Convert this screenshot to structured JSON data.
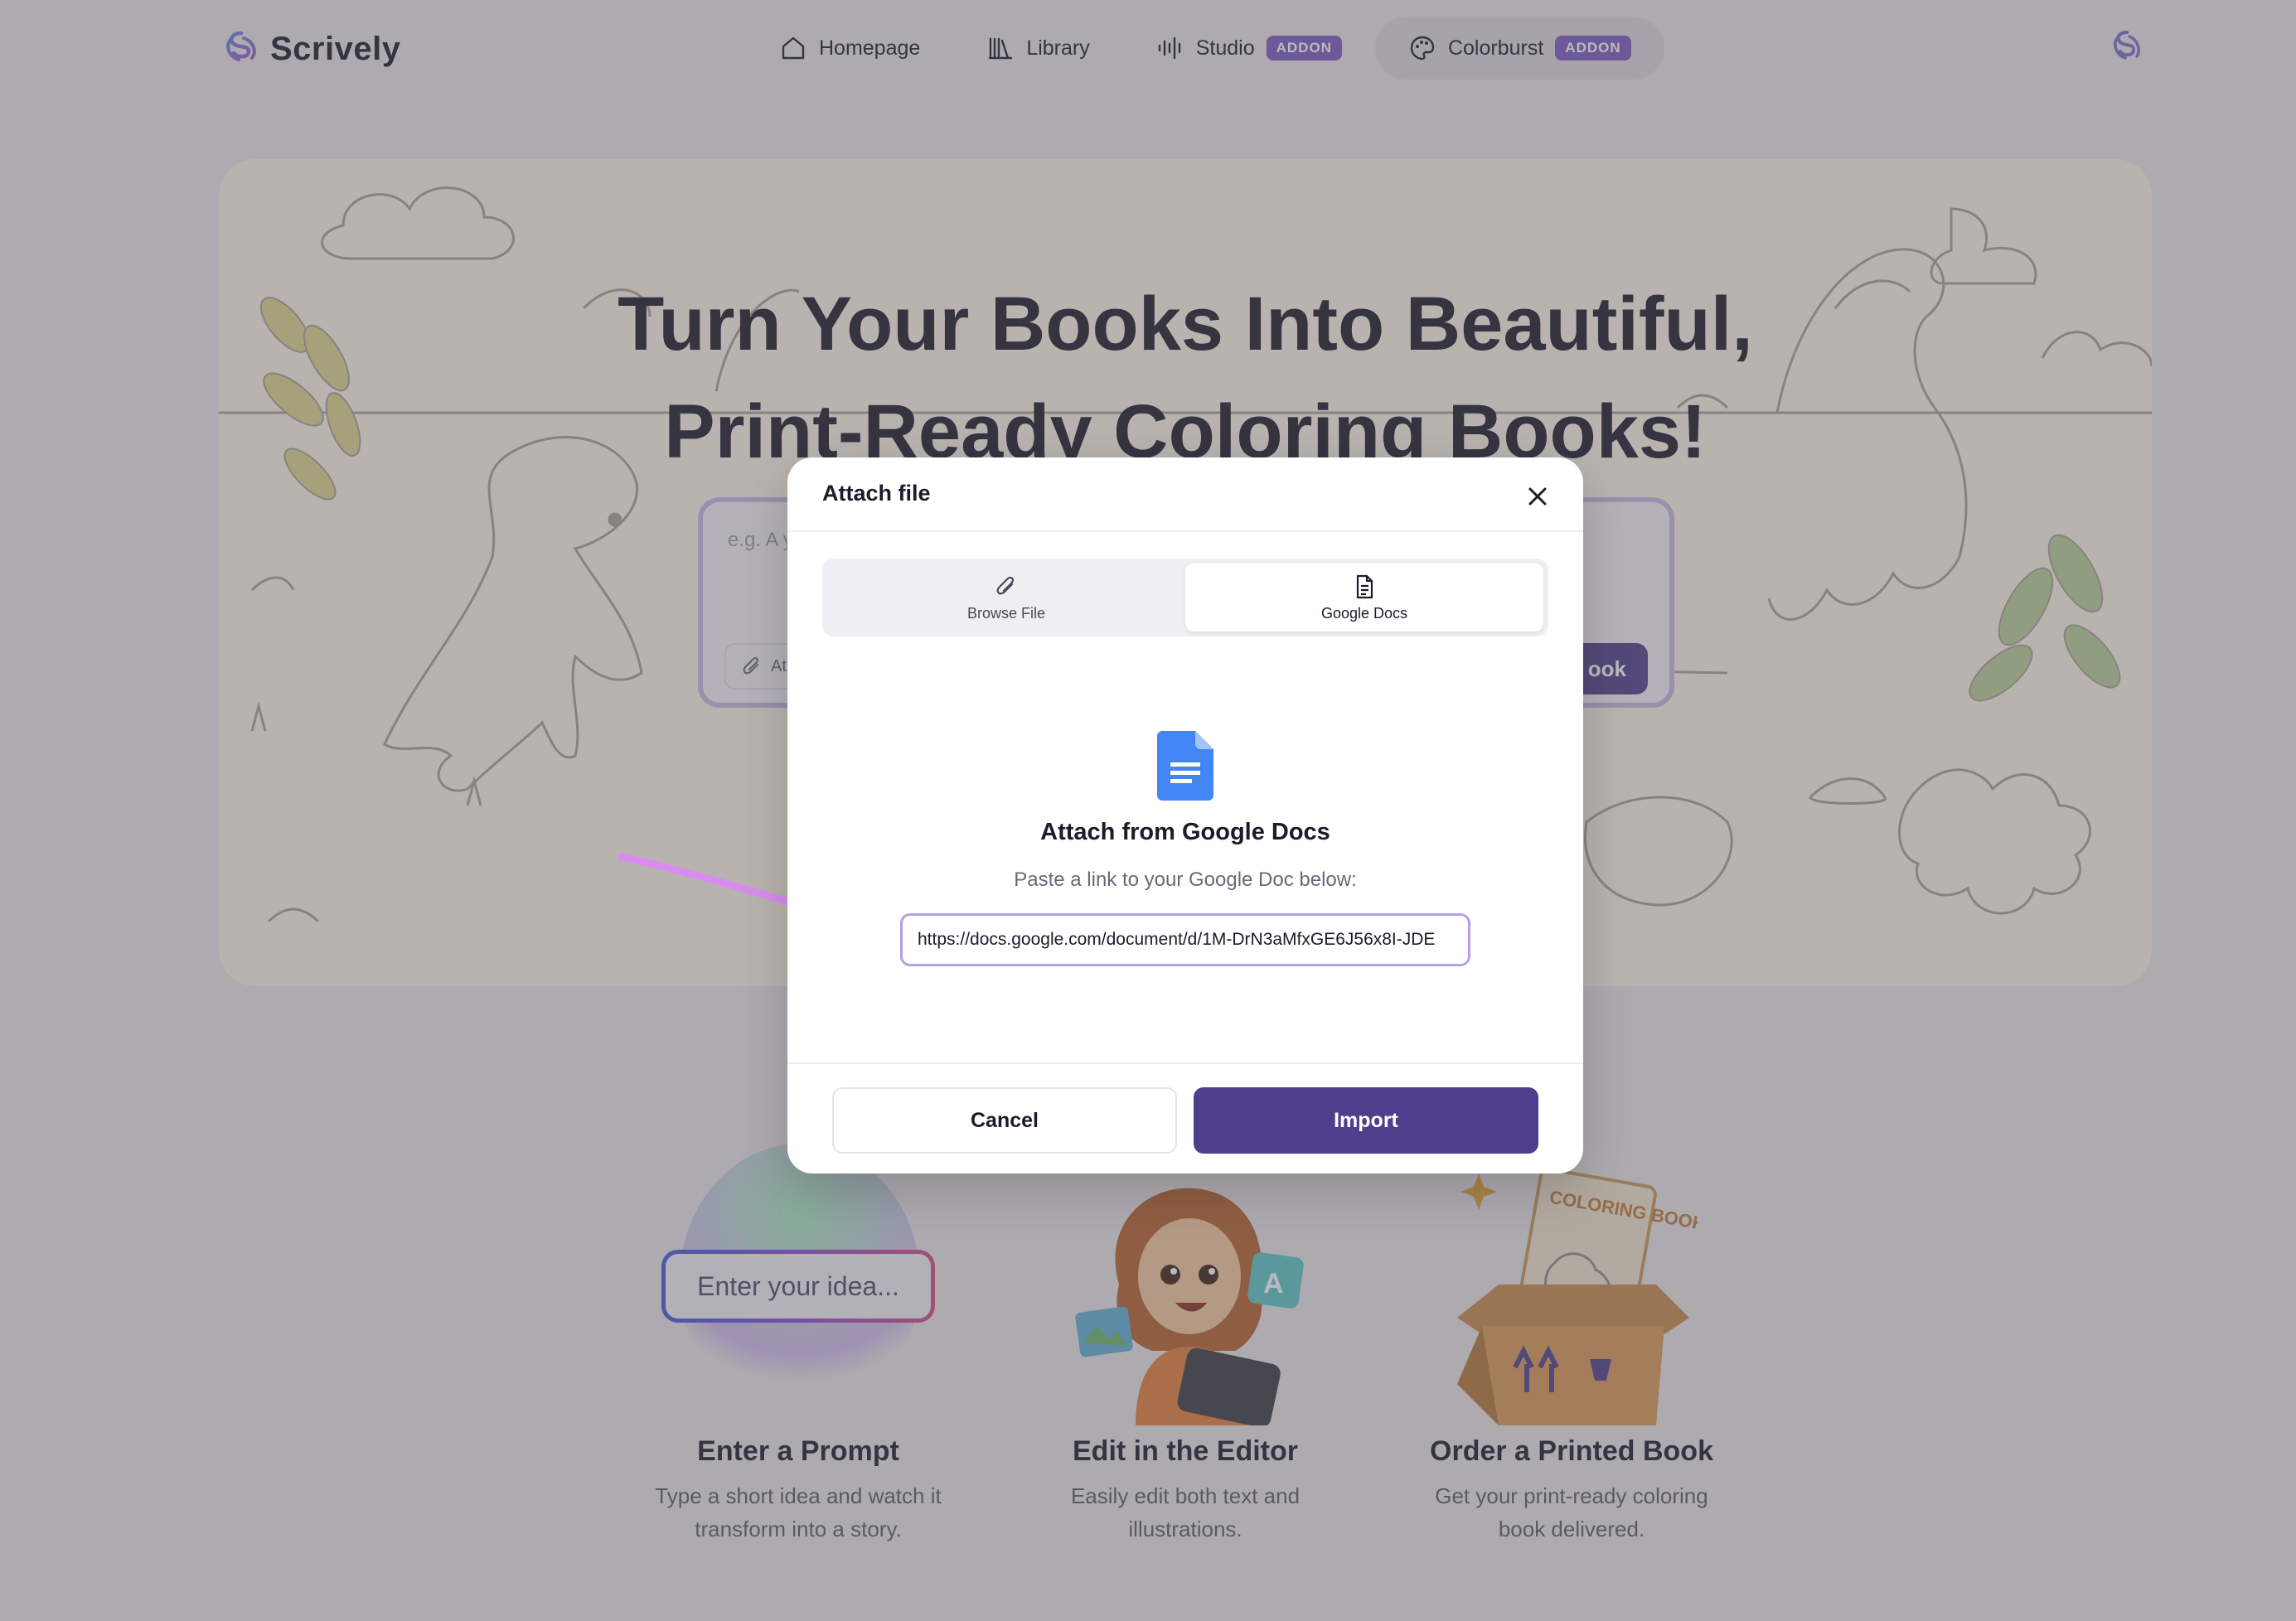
{
  "brand": {
    "name": "Scrively"
  },
  "nav": {
    "items": [
      {
        "label": "Homepage",
        "icon": "home-icon"
      },
      {
        "label": "Library",
        "icon": "library-icon"
      },
      {
        "label": "Studio",
        "icon": "audio-wave-icon",
        "badge": "ADDON"
      },
      {
        "label": "Colorburst",
        "icon": "palette-icon",
        "badge": "ADDON",
        "active": true
      }
    ]
  },
  "hero": {
    "title_line1": "Turn Your Books Into Beautiful,",
    "title_line2": "Print-Ready Coloring Books!",
    "prompt_placeholder": "e.g. A y",
    "attach_label": "At",
    "create_label": "ook"
  },
  "steps": [
    {
      "title": "Enter a Prompt",
      "desc_line1": "Type a short idea and watch it",
      "desc_line2": "transform into a story.",
      "pill": "Enter your idea..."
    },
    {
      "title": "Edit in the Editor",
      "desc_line1": "Easily edit both text and",
      "desc_line2": "illustrations."
    },
    {
      "title": "Order a Printed Book",
      "desc_line1": "Get your print-ready coloring",
      "desc_line2": "book delivered.",
      "box_text": "COLORING BOOK"
    }
  ],
  "modal": {
    "title": "Attach file",
    "tabs": [
      {
        "label": "Browse File",
        "icon": "paperclip-icon"
      },
      {
        "label": "Google Docs",
        "icon": "document-icon",
        "selected": true
      }
    ],
    "heading": "Attach from Google Docs",
    "subtext": "Paste a link to your Google Doc below:",
    "link_value": "https://docs.google.com/document/d/1M-DrN3aMfxGE6J56x8I-JDE",
    "cancel_label": "Cancel",
    "import_label": "Import"
  },
  "colors": {
    "primary": "#4e3f8c",
    "badge": "#7b5bc4",
    "input_focus": "#b59fe6",
    "gdocs_blue": "#4285f4",
    "annotation_arrow": "#d98cf0"
  }
}
